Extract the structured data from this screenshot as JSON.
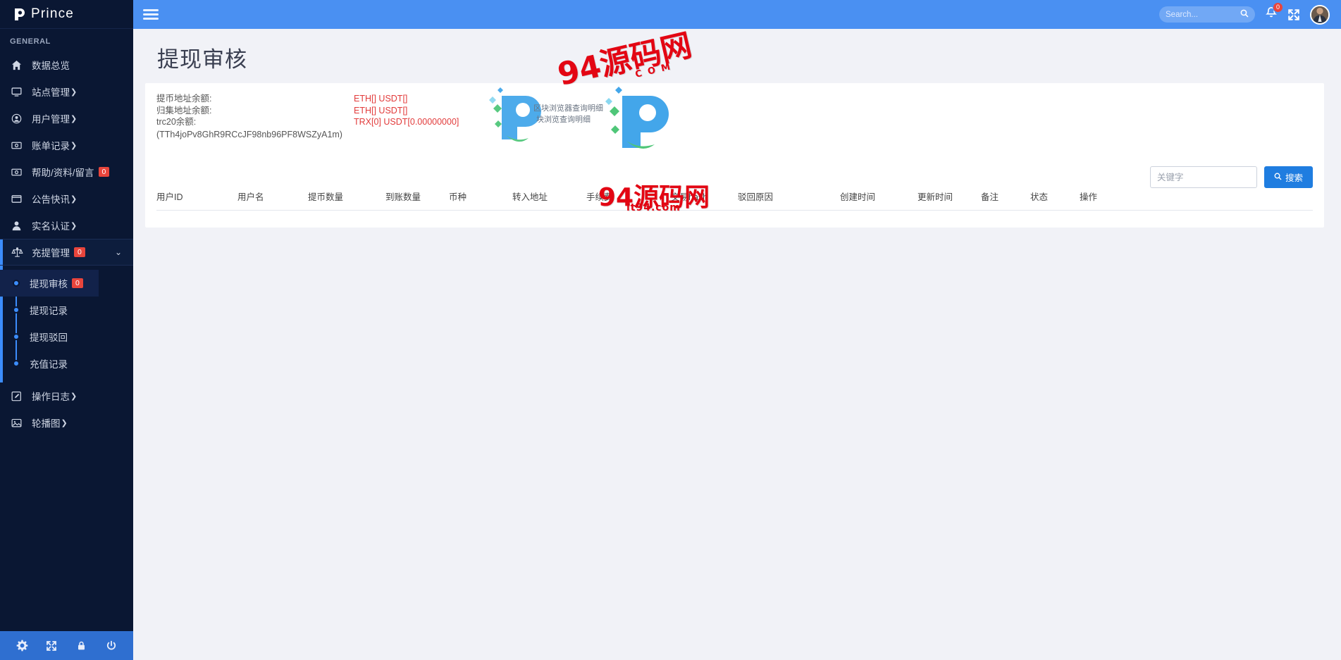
{
  "brand": {
    "name": "Prince",
    "logo_icon": "p-logo-icon"
  },
  "sidebar": {
    "section_title": "GENERAL",
    "items": [
      {
        "label": "数据总览",
        "icon": "home-icon",
        "caret": ""
      },
      {
        "label": "站点管理",
        "icon": "monitor-icon",
        "caret": "❯"
      },
      {
        "label": "用户管理",
        "icon": "user-circle-icon",
        "caret": "❯"
      },
      {
        "label": "账单记录",
        "icon": "money-icon",
        "caret": "❯"
      },
      {
        "label": "帮助/资料/留言",
        "icon": "money-icon",
        "caret": "",
        "badge": "0"
      },
      {
        "label": "公告快讯",
        "icon": "window-icon",
        "caret": "❯"
      },
      {
        "label": "实名认证",
        "icon": "user-icon",
        "caret": "❯"
      }
    ],
    "group": {
      "label": "充提管理",
      "icon": "scale-icon",
      "badge": "0",
      "chevron": "⌄",
      "submenu": [
        {
          "label": "提现审核",
          "badge": "0",
          "active": true
        },
        {
          "label": "提现记录",
          "active": false
        },
        {
          "label": "提现驳回",
          "active": false
        },
        {
          "label": "充值记录",
          "active": false
        }
      ]
    },
    "items_after": [
      {
        "label": "操作日志",
        "icon": "edit-square-icon",
        "caret": "❯"
      },
      {
        "label": "轮播图",
        "icon": "image-icon",
        "caret": "❯"
      }
    ],
    "bottom_icons": [
      "gear-icon",
      "expand-icon",
      "lock-icon",
      "power-icon"
    ]
  },
  "topbar": {
    "menu_toggle": "hamburger-icon",
    "search_placeholder": "Search...",
    "search_value": "",
    "search_icon": "search-icon",
    "bell_icon": "bell-icon",
    "bell_badge": "0",
    "fullscreen_icon": "fullscreen-icon",
    "avatar": "user-avatar"
  },
  "page": {
    "title": "提现审核",
    "balances": [
      {
        "label": "提币地址余额:",
        "value": "ETH[] USDT[]"
      },
      {
        "label": "归集地址余额:",
        "value": "ETH[] USDT[]"
      },
      {
        "label": "trc20余额:",
        "value": "TRX[0] USDT[0.00000000]"
      }
    ],
    "address": "(TTh4joPv8GhR9RCcJF98nb96PF8WSZyA1m)",
    "filter": {
      "keyword_placeholder": "关键字",
      "keyword_value": "",
      "search_button": "搜索",
      "search_button_icon": "search-icon"
    },
    "table": {
      "columns": [
        "用户ID",
        "用户名",
        "提币数量",
        "到账数量",
        "币种",
        "转入地址",
        "手续费",
        "交易hash",
        "驳回原因",
        "创建时间",
        "更新时间",
        "备注",
        "状态",
        "操作"
      ],
      "rows": []
    }
  },
  "watermarks": {
    "main_text": "94源码网",
    "domain": "it94.com",
    "top_text": "94源码网",
    "com_text": "C O M",
    "note1": "区块浏览器查询明细",
    "note2": "块浏览查询明细"
  },
  "colors": {
    "sidebar_bg": "#0a1733",
    "topbar_blue": "#4a90f2",
    "accent_blue": "#3c8dfd",
    "badge_red": "#e8453c",
    "value_red": "#e23b3b",
    "button_blue": "#1f7de0",
    "watermark_red": "#e30613"
  }
}
